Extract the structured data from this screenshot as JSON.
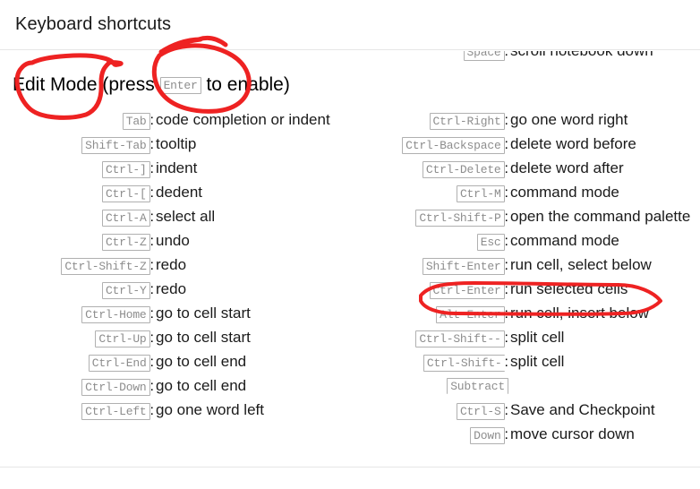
{
  "window": {
    "title": "Keyboard shortcuts"
  },
  "annotations": {
    "ink_color": "#ee2222",
    "shapes": [
      {
        "name": "ellipse-edit-mode",
        "label": "circle around 'Edit Mode'"
      },
      {
        "name": "ellipse-enter-key",
        "label": "circle around 'Enter' key badge"
      },
      {
        "name": "ellipse-ctrl-enter-row",
        "label": "oval around 'Ctrl-Enter : run selected cells'"
      }
    ]
  },
  "left_column": {
    "heading": {
      "before": "Edit Mode (press",
      "key": "Enter",
      "after": "to enable)"
    },
    "rows": [
      {
        "key": "Tab",
        "sep": ":",
        "desc": "code completion or indent"
      },
      {
        "key": "Shift-Tab",
        "sep": ":",
        "desc": "tooltip"
      },
      {
        "key": "Ctrl-]",
        "sep": ":",
        "desc": "indent"
      },
      {
        "key": "Ctrl-[",
        "sep": ":",
        "desc": "dedent"
      },
      {
        "key": "Ctrl-A",
        "sep": ":",
        "desc": "select all"
      },
      {
        "key": "Ctrl-Z",
        "sep": ":",
        "desc": "undo"
      },
      {
        "key": "Ctrl-Shift-Z",
        "sep": ":",
        "desc": "redo"
      },
      {
        "key": "Ctrl-Y",
        "sep": ":",
        "desc": "redo"
      },
      {
        "key": "Ctrl-Home",
        "sep": ":",
        "desc": "go to cell start"
      },
      {
        "key": "Ctrl-Up",
        "sep": ":",
        "desc": "go to cell start"
      },
      {
        "key": "Ctrl-End",
        "sep": ":",
        "desc": "go to cell end"
      },
      {
        "key": "Ctrl-Down",
        "sep": ":",
        "desc": "go to cell end"
      },
      {
        "key": "Ctrl-Left",
        "sep": ":",
        "desc": "go one word left"
      }
    ]
  },
  "right_column": {
    "clipped_row": {
      "key": "Space",
      "sep": ":",
      "desc": "scroll notebook down"
    },
    "rows": [
      {
        "key": "Ctrl-Right",
        "sep": ":",
        "desc": "go one word right"
      },
      {
        "key": "Ctrl-Backspace",
        "sep": ":",
        "desc": "delete word before"
      },
      {
        "key": "Ctrl-Delete",
        "sep": ":",
        "desc": "delete word after"
      },
      {
        "key": "Ctrl-M",
        "sep": ":",
        "desc": "command mode"
      },
      {
        "key": "Ctrl-Shift-P",
        "sep": ":",
        "desc": "open the command palette"
      },
      {
        "key": "Esc",
        "sep": ":",
        "desc": "command mode"
      },
      {
        "key": "Shift-Enter",
        "sep": ":",
        "desc": "run cell, select below"
      },
      {
        "key": "Ctrl-Enter",
        "sep": ":",
        "desc": "run selected cells"
      },
      {
        "key": "Alt-Enter",
        "sep": ":",
        "desc": "run cell, insert below"
      },
      {
        "key": "Ctrl-Shift--",
        "sep": ":",
        "desc": "split cell"
      },
      {
        "key": "Ctrl-Shift-",
        "sep": ":",
        "desc": "split cell"
      },
      {
        "key": "Subtract",
        "sep": "",
        "desc": ""
      },
      {
        "key": "Ctrl-S",
        "sep": ":",
        "desc": "Save and Checkpoint"
      },
      {
        "key": "Down",
        "sep": ":",
        "desc": "move cursor down"
      }
    ]
  }
}
